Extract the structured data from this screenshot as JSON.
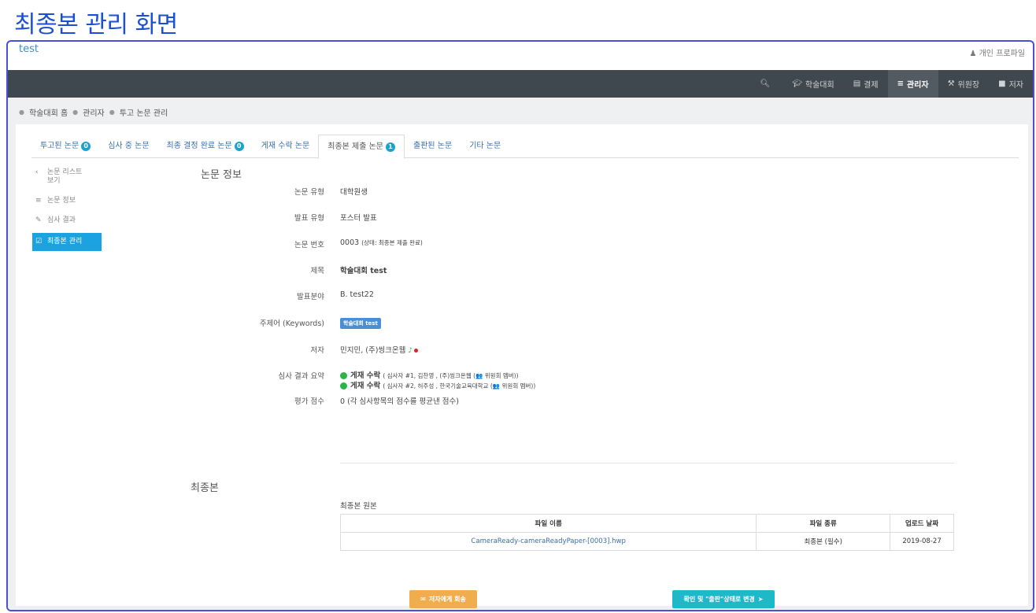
{
  "page_title": "최종본 관리 화면",
  "header": {
    "site_name": "test",
    "profile_link": "개인 프로파일"
  },
  "nav": {
    "items": [
      {
        "label": "",
        "icon": "search-icon"
      },
      {
        "label": "학술대회",
        "icon": "graduation-cap-icon"
      },
      {
        "label": "결제",
        "icon": "credit-card-icon"
      },
      {
        "label": "관리자",
        "icon": "list-icon",
        "active": true
      },
      {
        "label": "위원장",
        "icon": "gavel-icon"
      },
      {
        "label": "저자",
        "icon": "book-icon"
      }
    ]
  },
  "breadcrumb": [
    "학술대회 홈",
    "관리자",
    "투고 논문 관리"
  ],
  "tabs": [
    {
      "label": "투고된 논문",
      "badge": "0"
    },
    {
      "label": "심사 중 논문",
      "badge": ""
    },
    {
      "label": "최종 결정 완료 논문",
      "badge": "0"
    },
    {
      "label": "게재 수락 논문",
      "badge": ""
    },
    {
      "label": "최종본 제출 논문",
      "badge": "1",
      "active": true
    },
    {
      "label": "출판된 논문",
      "badge": ""
    },
    {
      "label": "기타 논문",
      "badge": ""
    }
  ],
  "sidenav": {
    "back_label_1": "논문 리스트",
    "back_label_2": "보기",
    "info_label": "논문 정보",
    "review_label": "심사 결과",
    "final_label": "최종본 관리"
  },
  "paper_info": {
    "section_title": "논문 정보",
    "type_label": "논문 유형",
    "type_value": "대학원생",
    "present_label": "발표 유형",
    "present_value": "포스터 발표",
    "number_label": "논문 번호",
    "number_value": "0003",
    "number_status": "(상태: 최종본 제출 완료)",
    "title_label": "제목",
    "title_value": "학술대회 test",
    "field_label": "발표분야",
    "field_value": "B. test22",
    "keywords_label": "주제어 (Keywords)",
    "keyword_tag": "학술대회 test",
    "author_label": "저자",
    "author_value": "민지민, (주)씽크온웹",
    "review_label": "심사 결과 요약",
    "review1_result": "게재 수락",
    "review1_detail": "( 심사자 #1, 김찬영 , (주)씽크온웹 (👥 위원회 멤버))",
    "review2_result": "게재 수락",
    "review2_detail": "( 심사자 #2, 허주성 , 한국기술교육대학교 (👥 위원회 멤버))",
    "score_label": "평가 점수",
    "score_value": "0 (각 심사항목의 점수를 평균낸 점수)"
  },
  "final": {
    "section_title": "최종본",
    "subtitle": "최종본 원본",
    "columns": [
      "파일 이름",
      "파일 종류",
      "업로드 날짜"
    ],
    "rows": [
      [
        "CameraReady-cameraReadyPaper-[0003].hwp",
        "최종본 (필수)",
        "2019-08-27"
      ]
    ]
  },
  "buttons": {
    "return_label": "저자에게 회송",
    "publish_label": "확인 및 \"출판\"상태로 변경"
  },
  "colors": {
    "navbar": "#3f474f",
    "accent_blue": "#1ba2e0",
    "orange_button": "#f0ad4e",
    "teal_button": "#1eb9c9",
    "frame_border": "#4a4fd8"
  }
}
